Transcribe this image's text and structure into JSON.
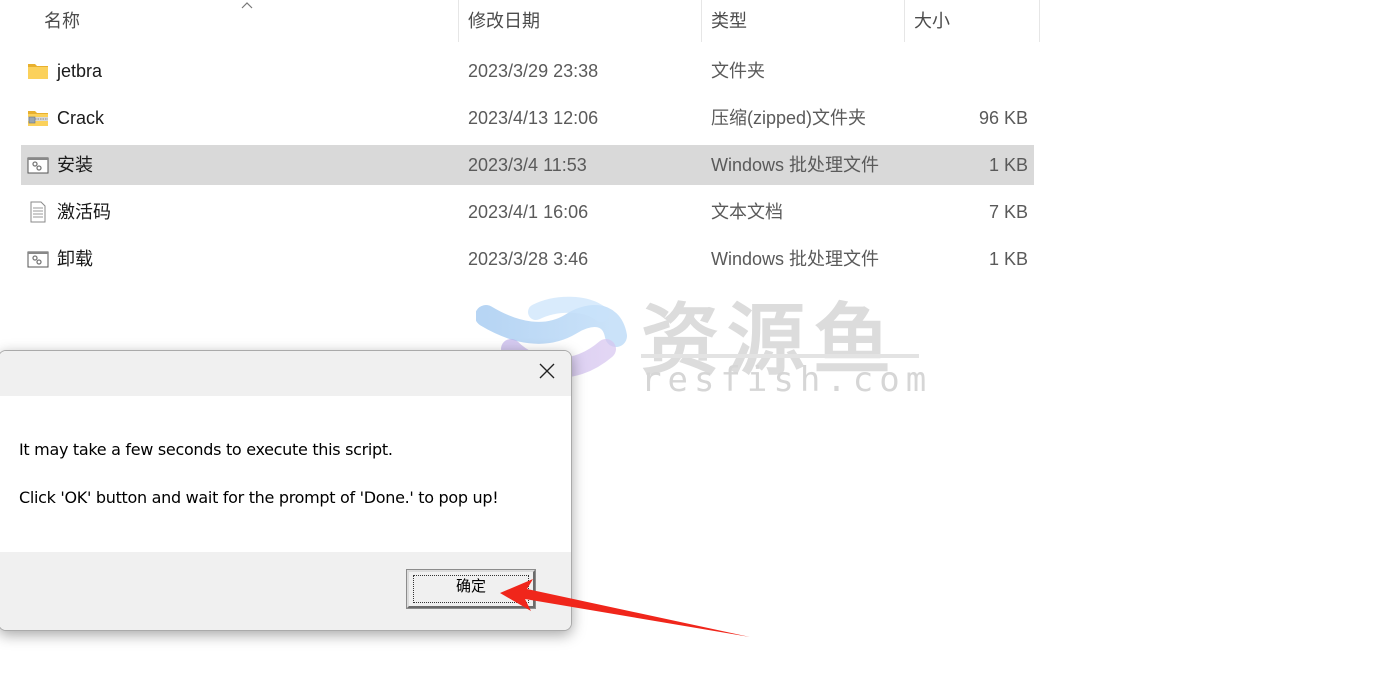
{
  "explorer": {
    "columns": {
      "name": "名称",
      "date": "修改日期",
      "type": "类型",
      "size": "大小"
    },
    "sort": {
      "column": "name",
      "direction": "ascending",
      "icon": "chevron-up-icon"
    },
    "files": [
      {
        "name": "jetbra",
        "date": "2023/3/29 23:38",
        "type": "文件夹",
        "size": "",
        "icon": "folder-icon",
        "selected": false
      },
      {
        "name": "Crack",
        "date": "2023/4/13 12:06",
        "type": "压缩(zipped)文件夹",
        "size": "96 KB",
        "icon": "zip-folder-icon",
        "selected": false
      },
      {
        "name": "安装",
        "date": "2023/3/4 11:53",
        "type": "Windows 批处理文件",
        "size": "1 KB",
        "icon": "batch-file-icon",
        "selected": true
      },
      {
        "name": "激活码",
        "date": "2023/4/1 16:06",
        "type": "文本文档",
        "size": "7 KB",
        "icon": "text-file-icon",
        "selected": false
      },
      {
        "name": "卸载",
        "date": "2023/3/28 3:46",
        "type": "Windows 批处理文件",
        "size": "1 KB",
        "icon": "batch-file-icon",
        "selected": false
      }
    ]
  },
  "watermark": {
    "cn": "资源鱼",
    "en": "resfish.com"
  },
  "dialog": {
    "close_icon": "close-icon",
    "message_line1": "It may take a few seconds to execute this script.",
    "message_line2": "Click 'OK' button and wait for the prompt of 'Done.' to pop up!",
    "ok_label": "确定"
  },
  "annotation": {
    "arrow_color": "#f0261b",
    "points_to": "ok-button"
  },
  "colors": {
    "selected_row": "#d9d9d9",
    "dialog_bg": "#f0f0f0",
    "folder_yellow": "#f5c842"
  }
}
